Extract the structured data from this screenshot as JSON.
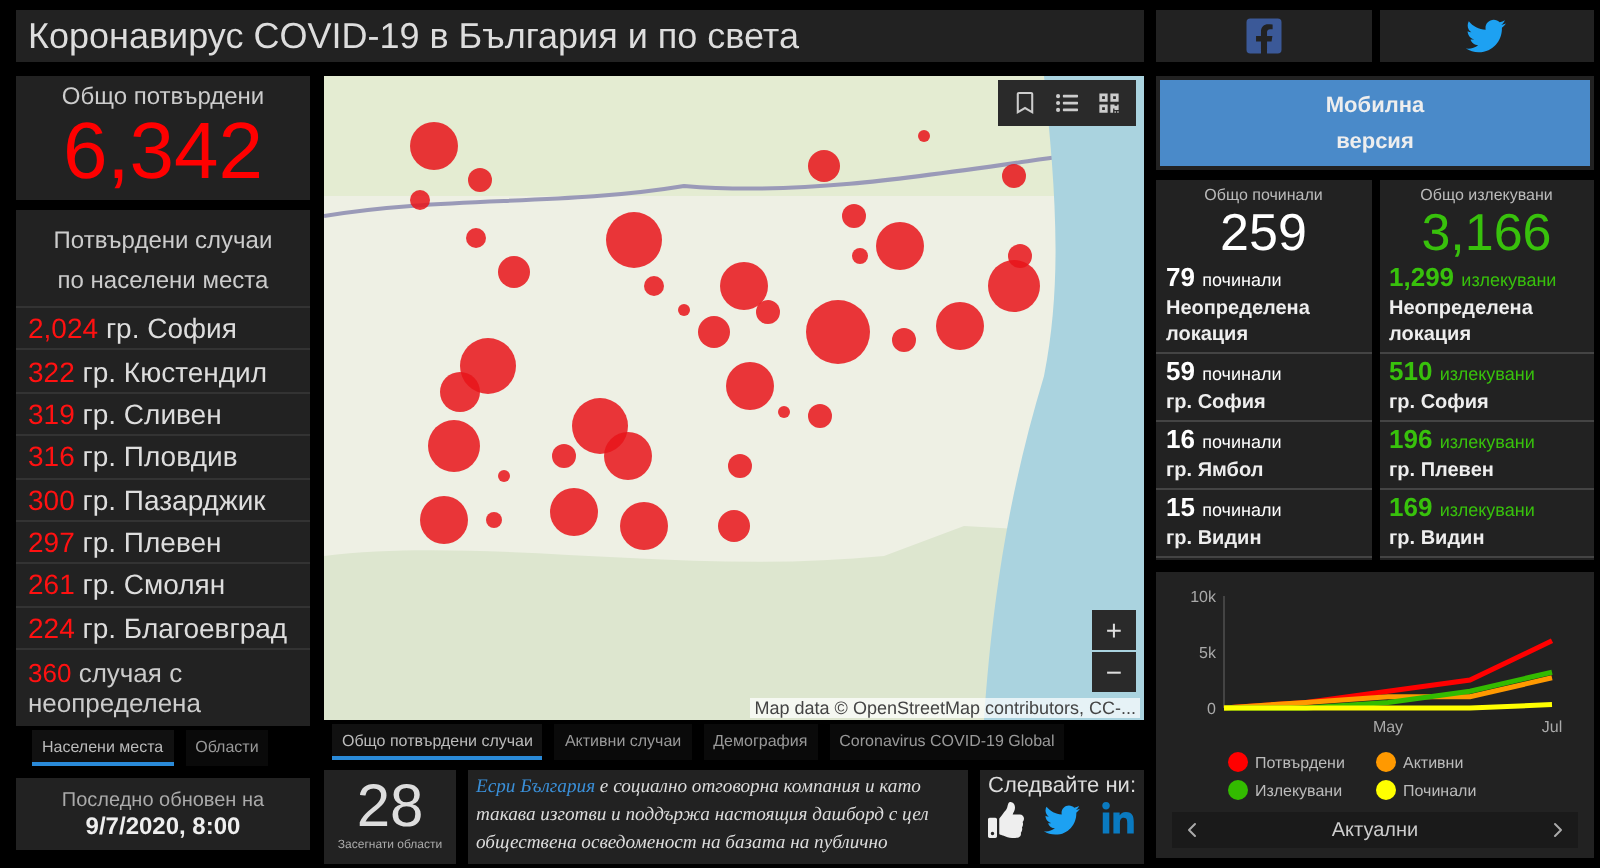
{
  "header": {
    "title": "Коронавирус COVID-19 в България и по света"
  },
  "social": [
    {
      "kind": "facebook"
    },
    {
      "kind": "twitter"
    }
  ],
  "total_confirmed": {
    "label": "Общо потвърдени",
    "value": "6,342"
  },
  "places": {
    "title": "Потвърдени случаи по населени места",
    "rows": [
      {
        "count": "2,024",
        "name": "гр. София"
      },
      {
        "count": "322",
        "name": "гр. Кюстендил"
      },
      {
        "count": "319",
        "name": "гр. Сливен"
      },
      {
        "count": "316",
        "name": "гр. Пловдив"
      },
      {
        "count": "300",
        "name": "гр. Пазарджик"
      },
      {
        "count": "297",
        "name": "гр. Плевен"
      },
      {
        "count": "261",
        "name": "гр. Смолян"
      },
      {
        "count": "224",
        "name": "гр. Благоевград"
      }
    ],
    "footer": {
      "count": "360",
      "text": "случая с неопределена"
    }
  },
  "left_tabs": [
    {
      "label": "Населени места",
      "selected": true
    },
    {
      "label": "Области",
      "selected": false
    }
  ],
  "updated": {
    "label": "Последно обновен на",
    "value": "9/7/2020, 8:00"
  },
  "map": {
    "attribution": "Map data © OpenStreetMap contributors, CC-...",
    "zoom_in": "+",
    "zoom_out": "−"
  },
  "map_tabs": [
    {
      "label": "Общо потвърдени случаи",
      "selected": true
    },
    {
      "label": "Активни случаи",
      "selected": false
    },
    {
      "label": "Демография",
      "selected": false
    },
    {
      "label": "Coronavirus COVID-19 Global",
      "selected": false
    }
  ],
  "regions": {
    "value": "28",
    "label": "Засегнати области"
  },
  "about": {
    "link": "Есри България",
    "text": " е социално отговорна компания и като такава изготви и поддържа настоящия дашборд с цел обществена осведоменост на базата на публично"
  },
  "follow": {
    "title": "Следвайте ни:",
    "links": [
      {
        "kind": "like"
      },
      {
        "kind": "twitter"
      },
      {
        "kind": "linkedin"
      }
    ]
  },
  "mobile_button": {
    "lines": [
      "Мобилна",
      "версия"
    ]
  },
  "deaths": {
    "label": "Общо починали",
    "value": "259",
    "rows": [
      {
        "count": "79",
        "unit": "починали",
        "place": "Неопределена локация"
      },
      {
        "count": "59",
        "unit": "починали",
        "place": "гр. София"
      },
      {
        "count": "16",
        "unit": "починали",
        "place": "гр. Ямбол"
      },
      {
        "count": "15",
        "unit": "починали",
        "place": "гр. Видин"
      }
    ]
  },
  "recovered": {
    "label": "Общо излекувани",
    "value": "3,166",
    "rows": [
      {
        "count": "1,299",
        "unit": "излекувани",
        "place": "Неопределена локация"
      },
      {
        "count": "510",
        "unit": "излекувани",
        "place": "гр. София"
      },
      {
        "count": "196",
        "unit": "излекувани",
        "place": "гр. Плевен"
      },
      {
        "count": "169",
        "unit": "излекувани",
        "place": "гр. Видин"
      }
    ]
  },
  "chart": {
    "chart_data": {
      "type": "line",
      "categories": [
        null,
        null,
        "May",
        null,
        "Jul"
      ],
      "ylim": [
        0,
        10000
      ],
      "yticks": [
        {
          "value": 0,
          "label": "0"
        },
        {
          "value": 5000,
          "label": "5k"
        },
        {
          "value": 10000,
          "label": "10k"
        }
      ],
      "series": [
        {
          "name": "Потвърдени",
          "color": "#ff0000",
          "values": [
            0,
            500,
            1500,
            2500,
            6000
          ]
        },
        {
          "name": "Активни",
          "color": "#ff9900",
          "values": [
            0,
            500,
            1000,
            1000,
            2700
          ]
        },
        {
          "name": "Излекувани",
          "color": "#33bb00",
          "values": [
            0,
            0,
            500,
            1500,
            3200
          ]
        },
        {
          "name": "Починали",
          "color": "#ffff00",
          "values": [
            0,
            0,
            0,
            0,
            300
          ]
        }
      ]
    },
    "nav_label": "Актуални"
  }
}
